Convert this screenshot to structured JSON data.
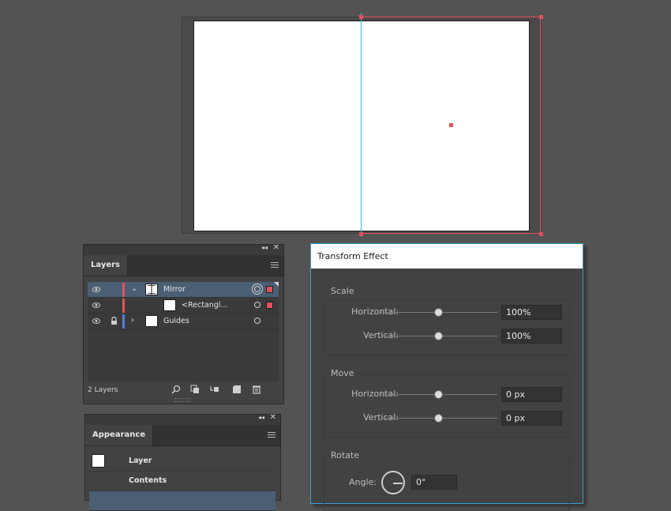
{
  "layers_panel": {
    "tab_label": "Layers",
    "rows": [
      {
        "name": "Mirror"
      },
      {
        "name": "<Rectangl..."
      },
      {
        "name": "Guides"
      }
    ],
    "footer_count": "2 Layers",
    "layer_colors": {
      "mirror": "#e8505b",
      "guides": "#4f7fe0"
    }
  },
  "appearance_panel": {
    "tab_label": "Appearance",
    "rows": [
      {
        "label": "Layer"
      },
      {
        "label": "Contents"
      }
    ]
  },
  "transform_effect": {
    "title": "Transform Effect",
    "scale": {
      "label": "Scale",
      "horizontal_label": "Horizontal:",
      "horizontal_value": "100%",
      "vertical_label": "Vertical:",
      "vertical_value": "100%"
    },
    "move": {
      "label": "Move",
      "horizontal_label": "Horizontal:",
      "horizontal_value": "0 px",
      "vertical_label": "Vertical:",
      "vertical_value": "0 px"
    },
    "rotate": {
      "label": "Rotate",
      "angle_label": "Angle:",
      "angle_value": "0°"
    }
  },
  "colors": {
    "selection": "#e8505b",
    "guide": "#35b4d9",
    "dialog_border": "#35a0d9"
  }
}
